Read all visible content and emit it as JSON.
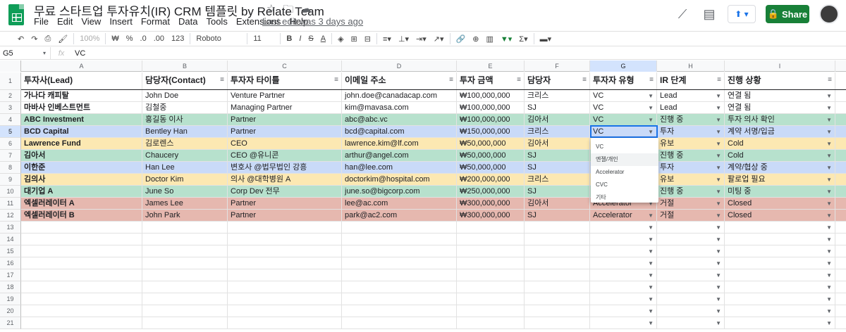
{
  "title_bar": {
    "doc_title": "무료 스타트업 투자유치(IR) CRM 템플릿 by Relate Team",
    "menu": [
      "File",
      "Edit",
      "View",
      "Insert",
      "Format",
      "Data",
      "Tools",
      "Extensions",
      "Help"
    ],
    "last_edit": "Last edit was 3 days ago",
    "share_label": "Share",
    "icons": [
      "star-icon",
      "move-icon",
      "cloud-icon",
      "trend-icon",
      "comment-icon",
      "present-icon"
    ]
  },
  "toolbar": {
    "zoom": "100%",
    "currency": "₩",
    "percent": "%",
    "decrease_decimal": ".0",
    "increase_decimal": ".00",
    "number_format": "123",
    "font": "Roboto",
    "font_size": "11",
    "bold": "B",
    "italic": "I",
    "strike": "S",
    "text_color": "A"
  },
  "formula_bar": {
    "cell_ref": "G5",
    "fx": "fx",
    "value": "VC"
  },
  "columns": [
    "A",
    "B",
    "C",
    "D",
    "E",
    "F",
    "G",
    "H",
    "I"
  ],
  "headers": [
    "투자사(Lead)",
    "담당자(Contact)",
    "투자자 타이틀",
    "이메일 주소",
    "투자 금액",
    "담당자",
    "투자자 유형",
    "IR 단계",
    "진행 상황"
  ],
  "rows": [
    {
      "num": "2",
      "cells": [
        "가나다 캐피탈",
        "John Doe",
        "Venture Partner",
        "john.doe@canadacap.com",
        "₩100,000,000",
        "크리스",
        "VC",
        "Lead",
        "연결 됨"
      ]
    },
    {
      "num": "3",
      "cells": [
        "마바사 인베스트먼트",
        "김철중",
        "Managing Partner",
        "kim@mavasa.com",
        "₩100,000,000",
        "SJ",
        "VC",
        "Lead",
        "연결 됨"
      ]
    },
    {
      "num": "4",
      "cells": [
        "ABC Investment",
        "홍길동 이사",
        "Partner",
        "abc@abc.vc",
        "₩100,000,000",
        "김아서",
        "VC",
        "진행 중",
        "투자 의사 확인"
      ]
    },
    {
      "num": "5",
      "cells": [
        "BCD Capital",
        "Bentley Han",
        "Partner",
        "bcd@capital.com",
        "₩150,000,000",
        "크리스",
        "VC",
        "투자",
        "계약 서명/입금"
      ]
    },
    {
      "num": "6",
      "cells": [
        "Lawrence Fund",
        "김로렌스",
        "CEO",
        "lawrence.kim@lf.com",
        "₩50,000,000",
        "김아서",
        "",
        "유보",
        "Cold"
      ]
    },
    {
      "num": "7",
      "cells": [
        "김아서",
        "Chaucery",
        "CEO @유니콘",
        "arthur@angel.com",
        "₩50,000,000",
        "SJ",
        "",
        "진행 중",
        "Cold"
      ]
    },
    {
      "num": "8",
      "cells": [
        "이한준",
        "Han Lee",
        "변호사 @법무법인 강흥",
        "han@lee.com",
        "₩50,000,000",
        "SJ",
        "",
        "투자",
        "계약/협상 중"
      ]
    },
    {
      "num": "9",
      "cells": [
        "김의사",
        "Doctor Kim",
        "의사 @대학병원 A",
        "doctorkim@hospital.com",
        "₩200,000,000",
        "크리스",
        "",
        "유보",
        "팔로업 필요"
      ]
    },
    {
      "num": "10",
      "cells": [
        "대기업 A",
        "June So",
        "Corp Dev 전무",
        "june.so@bigcorp.com",
        "₩250,000,000",
        "SJ",
        "",
        "진행 중",
        "미팅 중"
      ]
    },
    {
      "num": "11",
      "cells": [
        "엑셀러레이터 A",
        "James Lee",
        "Partner",
        "lee@ac.com",
        "₩300,000,000",
        "김아서",
        "Accelerator",
        "거절",
        "Closed"
      ]
    },
    {
      "num": "12",
      "cells": [
        "엑셀러레이터 B",
        "John Park",
        "Partner",
        "park@ac2.com",
        "₩300,000,000",
        "SJ",
        "Accelerator",
        "거절",
        "Closed"
      ]
    }
  ],
  "empty_rows": [
    "13",
    "14",
    "15",
    "16",
    "17",
    "18",
    "19",
    "20",
    "21"
  ],
  "header_row_num": "1",
  "dropdown_options": [
    "VC",
    "엔젤/개인",
    "Accelerator",
    "CVC",
    "기타"
  ],
  "colors": {
    "green": "#b7e1cd",
    "blue": "#c9daf8",
    "yellow": "#fce8b2",
    "red": "#e6b8af",
    "accent": "#1a73e8",
    "share": "#188038"
  },
  "row_colors": [
    "white",
    "white",
    "green",
    "blue",
    "yellow",
    "green",
    "blue",
    "yellow",
    "green",
    "red",
    "red"
  ]
}
